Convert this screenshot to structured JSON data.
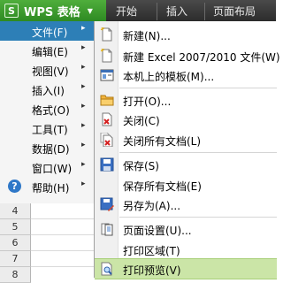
{
  "app": {
    "title": "WPS 表格",
    "logo_letter": "S"
  },
  "ribbon_tabs": [
    "开始",
    "插入",
    "页面布局"
  ],
  "left_menu": {
    "items": [
      {
        "label": "文件(F)",
        "selected": true
      },
      {
        "label": "编辑(E)"
      },
      {
        "label": "视图(V)"
      },
      {
        "label": "插入(I)"
      },
      {
        "label": "格式(O)"
      },
      {
        "label": "工具(T)"
      },
      {
        "label": "数据(D)"
      },
      {
        "label": "窗口(W)"
      },
      {
        "label": "帮助(H)"
      }
    ],
    "arrow": "▸"
  },
  "sheet": {
    "row_numbers": [
      "4",
      "5",
      "6",
      "7",
      "8"
    ]
  },
  "file_menu": {
    "items": [
      {
        "label": "新建(N)...",
        "icon": "new-document-icon"
      },
      {
        "label": "新建 Excel 2007/2010 文件(W)",
        "icon": "new-excel-icon"
      },
      {
        "label": "本机上的模板(M)...",
        "icon": "template-icon"
      },
      {
        "label": "打开(O)...",
        "icon": "open-folder-icon"
      },
      {
        "label": "关闭(C)",
        "icon": "close-document-icon"
      },
      {
        "label": "关闭所有文档(L)",
        "icon": "close-all-icon"
      },
      {
        "label": "保存(S)",
        "icon": "save-icon"
      },
      {
        "label": "保存所有文档(E)",
        "icon": ""
      },
      {
        "label": "另存为(A)...",
        "icon": "save-as-icon"
      },
      {
        "label": "页面设置(U)...",
        "icon": "page-setup-icon"
      },
      {
        "label": "打印区域(T)",
        "icon": ""
      },
      {
        "label": "打印预览(V)",
        "icon": "print-preview-icon",
        "highlighted": true
      }
    ]
  },
  "colors": {
    "accent_green": "#2e8a22",
    "selection_blue": "#2d7fb7",
    "hover_green": "#cbe5a7"
  }
}
